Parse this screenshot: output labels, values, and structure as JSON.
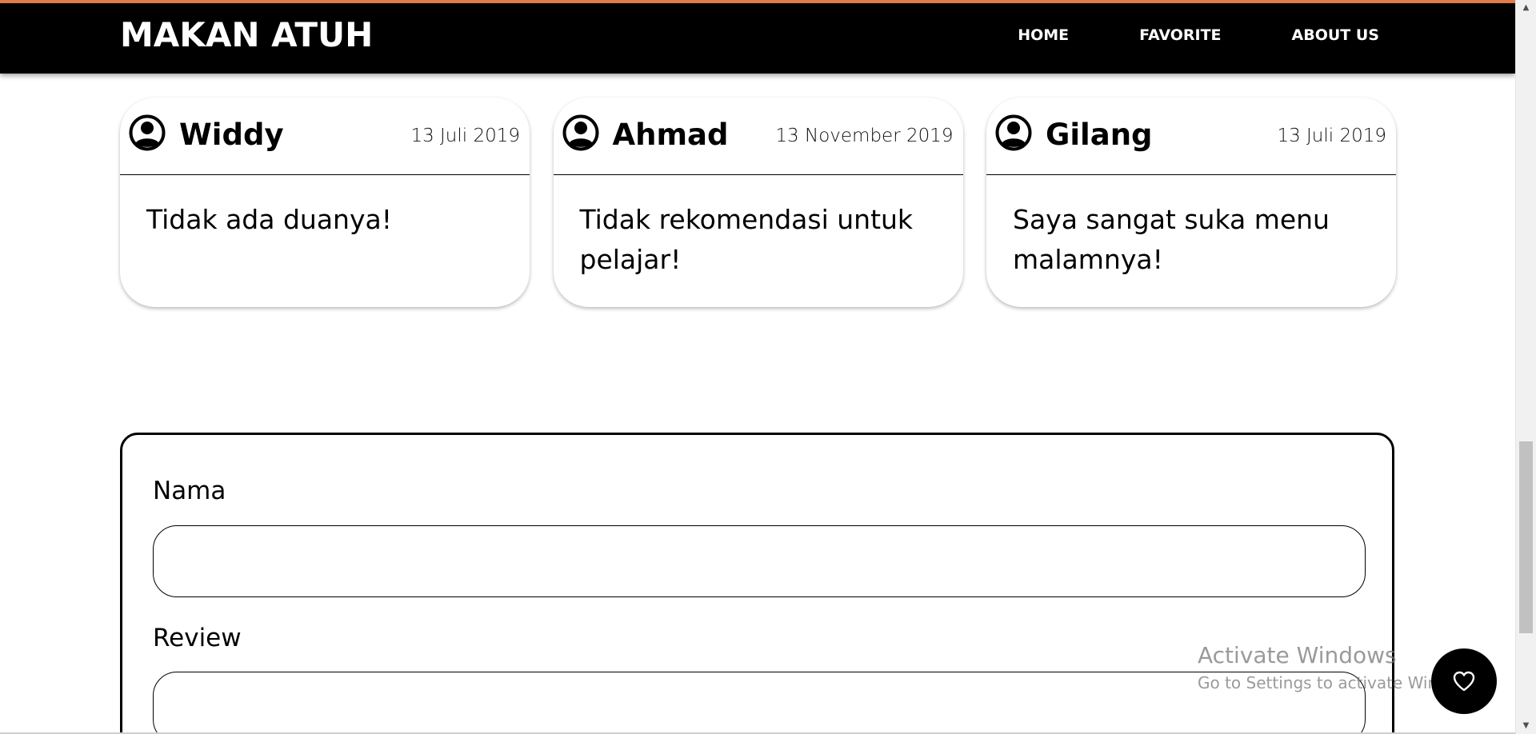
{
  "brand": {
    "title": "MAKAN ATUH"
  },
  "nav": {
    "items": [
      {
        "label": "HOME"
      },
      {
        "label": "FAVORITE"
      },
      {
        "label": "ABOUT US"
      }
    ]
  },
  "reviews": [
    {
      "name": "Widdy",
      "date": "13 Juli 2019",
      "text": "Tidak ada duanya!",
      "icon": "user-circle-icon"
    },
    {
      "name": "Ahmad",
      "date": "13 November 2019",
      "text": "Tidak rekomendasi untuk pelajar!",
      "icon": "user-circle-icon"
    },
    {
      "name": "Gilang",
      "date": "13 Juli 2019",
      "text": "Saya sangat suka menu malamnya!",
      "icon": "user-circle-icon"
    }
  ],
  "form": {
    "name_label": "Nama",
    "name_value": "",
    "review_label": "Review",
    "review_value": ""
  },
  "watermark": {
    "title": "Activate Windows",
    "subtitle": "Go to Settings to activate Windows."
  },
  "favorite_button": {
    "icon": "heart-icon"
  },
  "colors": {
    "navbar_bg": "#000000",
    "accent_line": "#e07b4a",
    "text": "#000000",
    "page_bg": "#ffffff"
  }
}
